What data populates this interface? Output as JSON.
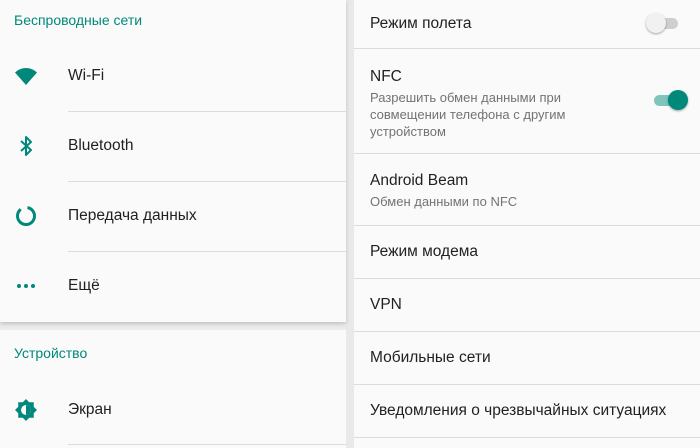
{
  "colors": {
    "accent": "#00897b",
    "divider": "#dcdcdc"
  },
  "left": {
    "wireless_header": "Беспроводные сети",
    "items": [
      {
        "label": "Wi-Fi",
        "icon": "wifi-icon"
      },
      {
        "label": "Bluetooth",
        "icon": "bluetooth-icon"
      },
      {
        "label": "Передача данных",
        "icon": "data-usage-icon"
      },
      {
        "label": "Ещё",
        "icon": "more-dots-icon"
      }
    ],
    "device_header": "Устройство",
    "device_items": [
      {
        "label": "Экран",
        "icon": "brightness-icon"
      }
    ]
  },
  "right": {
    "airplane": {
      "title": "Режим полета",
      "enabled": false
    },
    "nfc": {
      "title": "NFC",
      "subtitle": "Разрешить обмен данными при совмещении телефона с другим устройством",
      "enabled": true
    },
    "beam": {
      "title": "Android Beam",
      "subtitle": "Обмен данными по NFC"
    },
    "modem": {
      "title": "Режим модема"
    },
    "vpn": {
      "title": "VPN"
    },
    "mobile": {
      "title": "Мобильные сети"
    },
    "emergency": {
      "title": "Уведомления о чрезвычайных ситуациях"
    }
  }
}
